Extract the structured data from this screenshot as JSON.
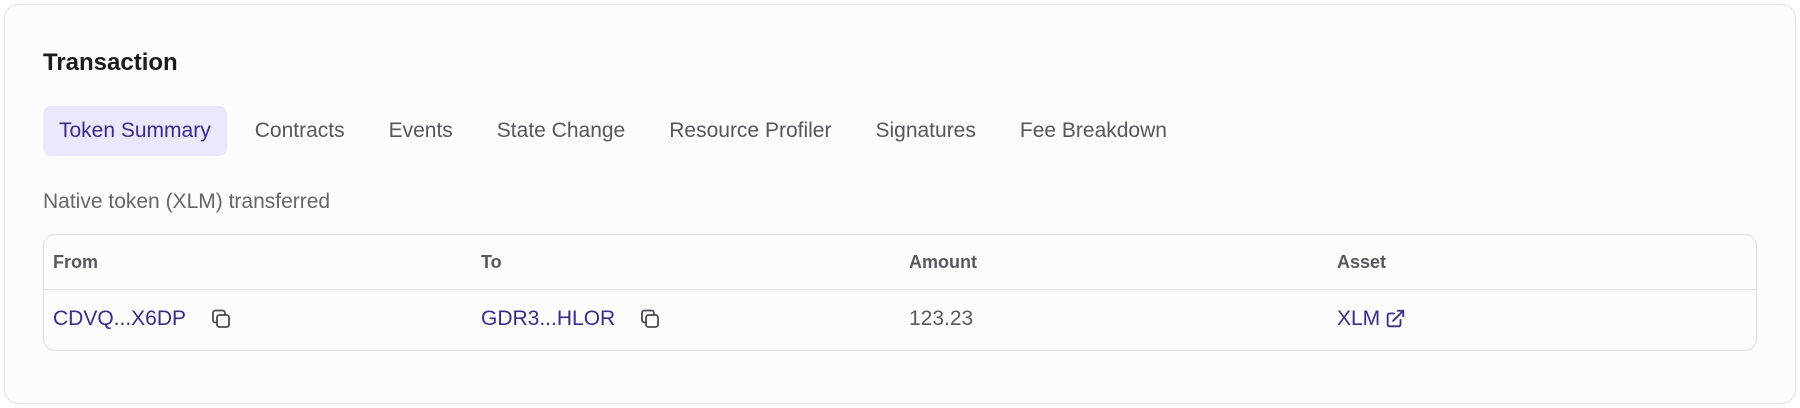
{
  "panel": {
    "title": "Transaction"
  },
  "tabs": [
    {
      "label": "Token Summary",
      "active": true
    },
    {
      "label": "Contracts",
      "active": false
    },
    {
      "label": "Events",
      "active": false
    },
    {
      "label": "State Change",
      "active": false
    },
    {
      "label": "Resource Profiler",
      "active": false
    },
    {
      "label": "Signatures",
      "active": false
    },
    {
      "label": "Fee Breakdown",
      "active": false
    }
  ],
  "summary": {
    "description": "Native token (XLM) transferred"
  },
  "table": {
    "headers": {
      "from": "From",
      "to": "To",
      "amount": "Amount",
      "asset": "Asset"
    },
    "rows": [
      {
        "from": "CDVQ...X6DP",
        "to": "GDR3...HLOR",
        "amount": "123.23",
        "asset": "XLM"
      }
    ]
  },
  "icons": {
    "copy": "copy-icon",
    "external_link": "external-link-icon"
  },
  "colors": {
    "accent": "#3c2a8a",
    "active_tab_bg": "#ebe7fc",
    "text_muted": "#58585e",
    "border": "#dfdfe3"
  }
}
